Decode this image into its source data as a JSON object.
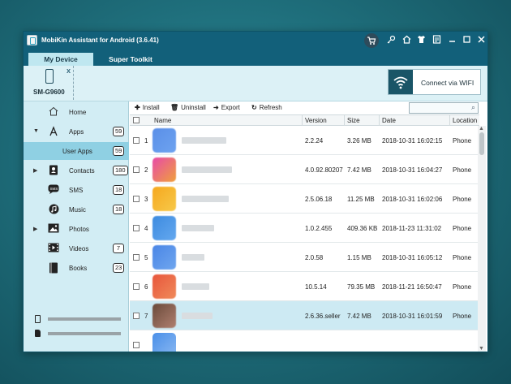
{
  "window": {
    "title": "MobiKin Assistant for Android (3.6.41)",
    "tabs": [
      "My Device",
      "Super Toolkit"
    ],
    "titlebar_icons": [
      "cart-icon",
      "key-icon",
      "home-icon",
      "shirt-icon",
      "feedback-icon",
      "minimize-icon",
      "maximize-icon",
      "close-icon"
    ]
  },
  "device": {
    "name": "SM-G9600",
    "close_glyph": "x"
  },
  "wifi_button": {
    "label": "Connect via WIFI"
  },
  "sidebar": {
    "home": {
      "label": "Home"
    },
    "apps": {
      "label": "Apps",
      "count": "59"
    },
    "user_apps": {
      "label": "User Apps",
      "count": "59"
    },
    "contacts": {
      "label": "Contacts",
      "count": "180"
    },
    "sms": {
      "label": "SMS",
      "count": "18"
    },
    "music": {
      "label": "Music",
      "count": "18"
    },
    "photos": {
      "label": "Photos"
    },
    "videos": {
      "label": "Videos",
      "count": "7"
    },
    "books": {
      "label": "Books",
      "count": "23"
    }
  },
  "toolbar": {
    "install": "Install",
    "uninstall": "Uninstall",
    "export": "Export",
    "refresh": "Refresh"
  },
  "table": {
    "columns": [
      "Name",
      "Version",
      "Size",
      "Date",
      "Location"
    ],
    "rows": [
      {
        "num": "1",
        "version": "2.2.24",
        "size": "3.26 MB",
        "date": "2018-10-31 16:02:15",
        "location": "Phone"
      },
      {
        "num": "2",
        "version": "4.0.92.80207",
        "size": "7.42 MB",
        "date": "2018-10-31 16:04:27",
        "location": "Phone"
      },
      {
        "num": "3",
        "version": "2.5.06.18",
        "size": "11.25 MB",
        "date": "2018-10-31 16:02:06",
        "location": "Phone"
      },
      {
        "num": "4",
        "version": "1.0.2.455",
        "size": "409.36 KB",
        "date": "2018-11-23 11:31:02",
        "location": "Phone"
      },
      {
        "num": "5",
        "version": "2.0.58",
        "size": "1.15 MB",
        "date": "2018-10-31 16:05:12",
        "location": "Phone"
      },
      {
        "num": "6",
        "version": "10.5.14",
        "size": "79.35 MB",
        "date": "2018-11-21 16:50:47",
        "location": "Phone"
      },
      {
        "num": "7",
        "version": "2.6.36.seller",
        "size": "7.42 MB",
        "date": "2018-10-31 16:01:59",
        "location": "Phone"
      }
    ]
  },
  "colors": {
    "titlebar": "#12607a",
    "selected_nav": "#8fd0e3",
    "sidebar_bg": "#d2edf4",
    "row_highlight": "#cdeaf3"
  }
}
